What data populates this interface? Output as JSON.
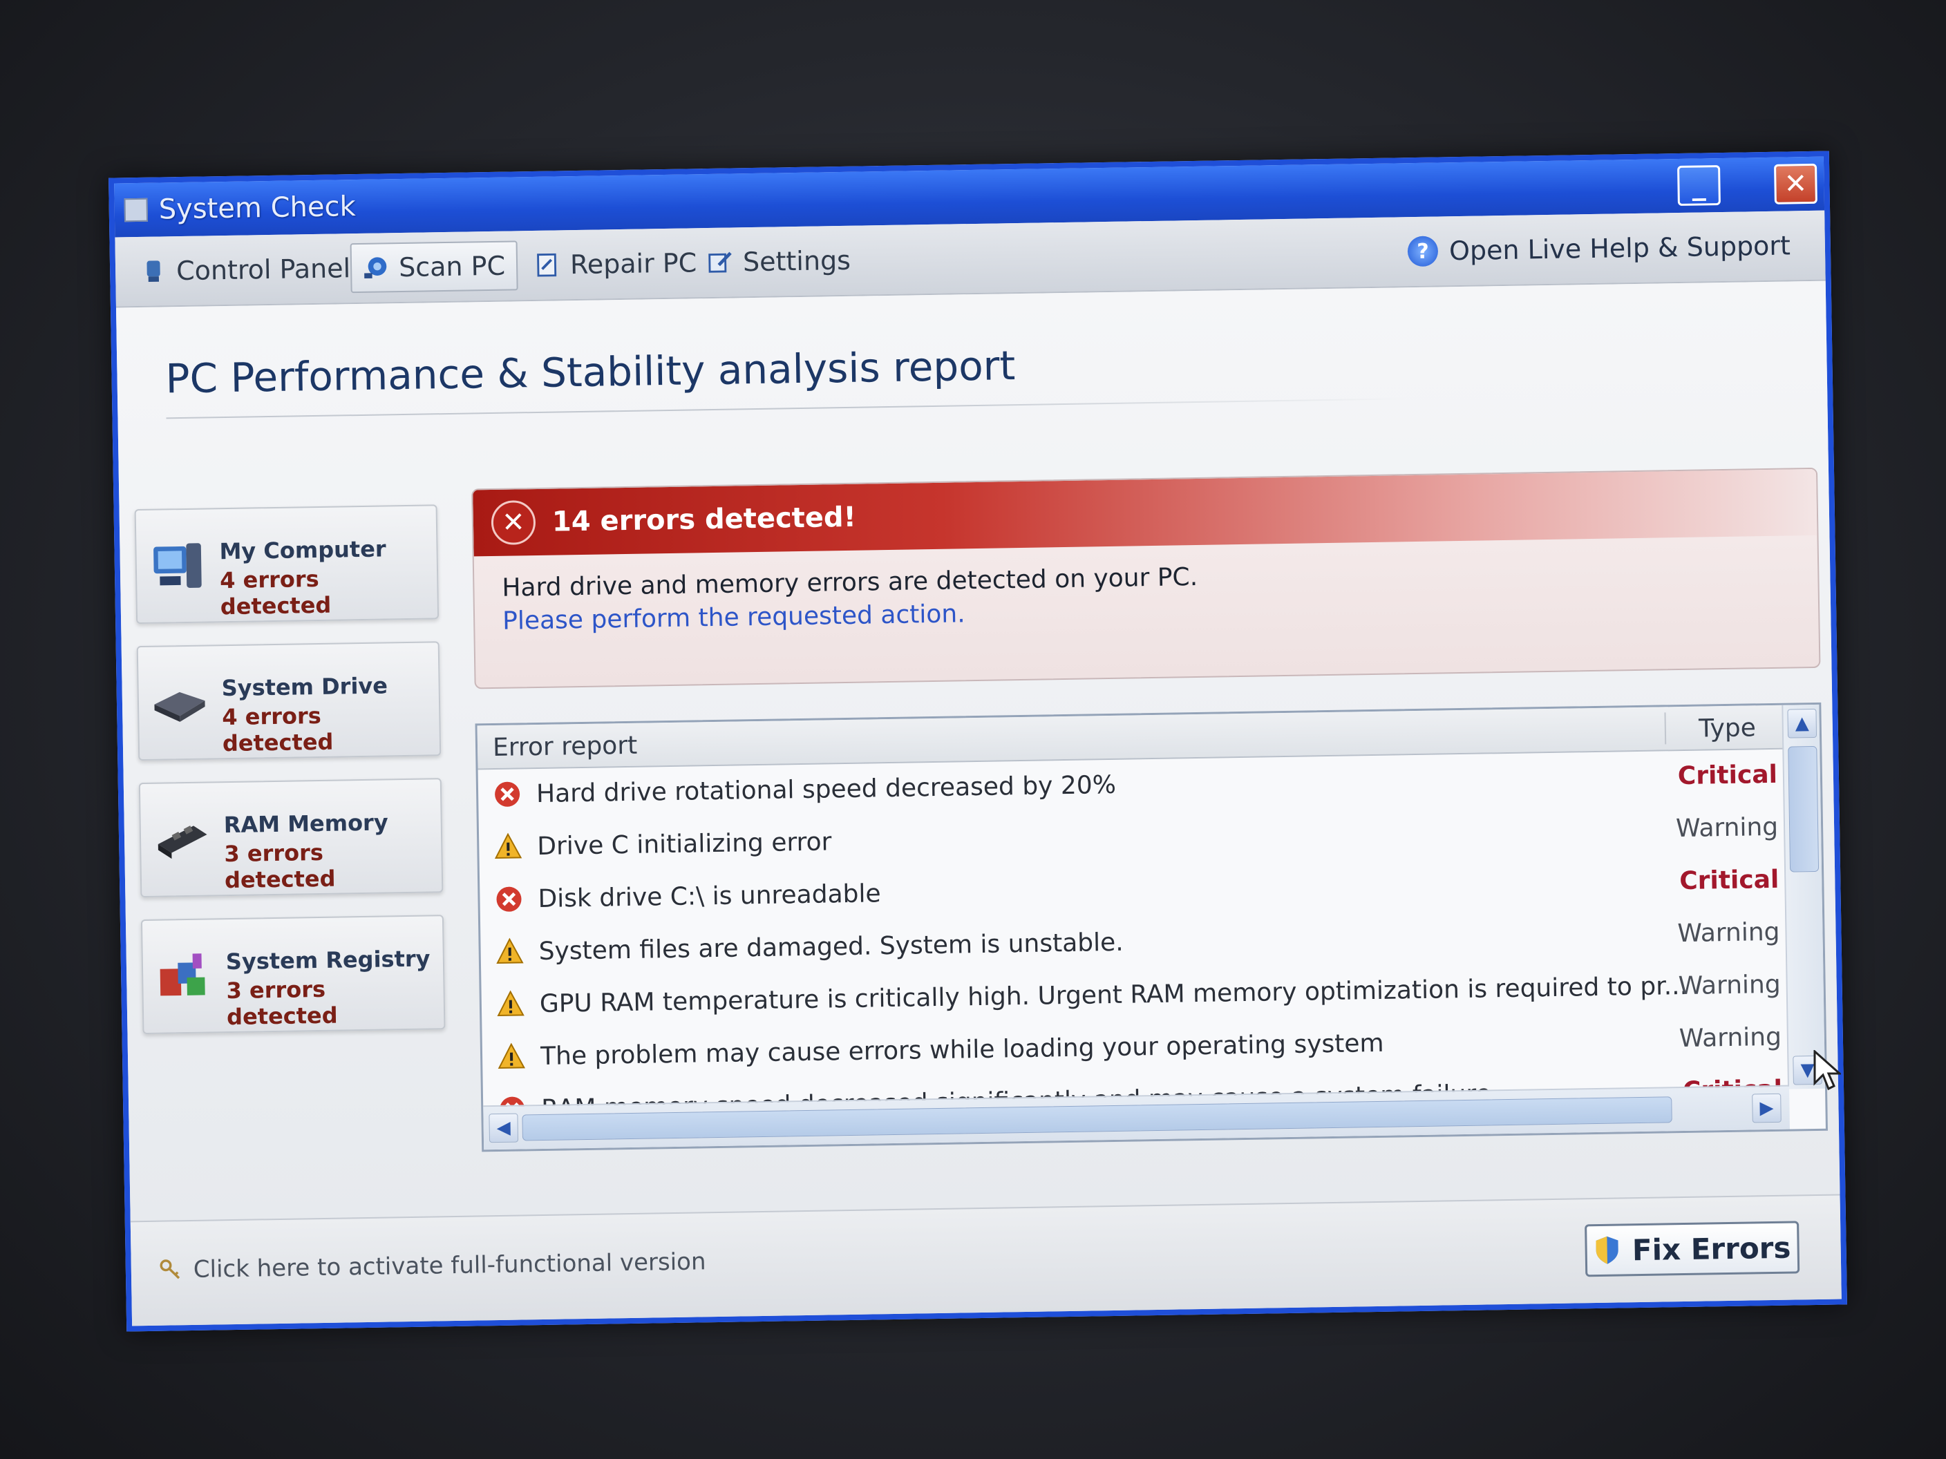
{
  "window": {
    "title": "System Check",
    "minimize_label": "_",
    "close_label": "✕"
  },
  "menu": {
    "items": [
      {
        "label": "Control Panel",
        "icon": "control-panel-icon"
      },
      {
        "label": "Scan PC",
        "icon": "scan-icon"
      },
      {
        "label": "Repair PC",
        "icon": "repair-icon"
      },
      {
        "label": "Settings",
        "icon": "settings-icon"
      }
    ],
    "help_label": "Open Live Help & Support",
    "help_icon_glyph": "?"
  },
  "main": {
    "heading": "PC Performance & Stability analysis report"
  },
  "sidebar": {
    "cards": [
      {
        "title": "My Computer",
        "sub": "4 errors detected",
        "icon": "computer-icon"
      },
      {
        "title": "System Drive",
        "sub": "4 errors detected",
        "icon": "drive-icon"
      },
      {
        "title": "RAM Memory",
        "sub": "3 errors detected",
        "icon": "ram-icon"
      },
      {
        "title": "System Registry",
        "sub": "3 errors detected",
        "icon": "registry-icon"
      }
    ]
  },
  "alert": {
    "icon_glyph": "✕",
    "title": "14 errors detected!",
    "line1": "Hard drive and memory errors are detected on your PC.",
    "line2": "Please perform the requested action."
  },
  "table": {
    "col_report": "Error report",
    "col_type": "Type",
    "rows": [
      {
        "text": "Hard drive rotational speed decreased by 20%",
        "type": "Critical",
        "level": "critical"
      },
      {
        "text": "Drive C initializing error",
        "type": "Warning",
        "level": "warning"
      },
      {
        "text": "Disk drive C:\\ is unreadable",
        "type": "Critical",
        "level": "critical"
      },
      {
        "text": "System files are damaged. System is unstable.",
        "type": "Warning",
        "level": "warning"
      },
      {
        "text": "GPU RAM temperature is critically high. Urgent RAM memory optimization is required to pr...",
        "type": "Warning",
        "level": "warning"
      },
      {
        "text": "The problem may cause errors while loading your operating system",
        "type": "Warning",
        "level": "warning"
      },
      {
        "text": "RAM memory speed decreased significantly and may cause a system failure",
        "type": "Critical",
        "level": "critical"
      }
    ]
  },
  "footer": {
    "activate_label": "Click here to activate full-functional version",
    "fix_label": "Fix Errors"
  },
  "colors": {
    "title_bar": "#1d4fd6",
    "critical": "#a2182c",
    "alert_red": "#b8241c",
    "link": "#2d55c8"
  }
}
